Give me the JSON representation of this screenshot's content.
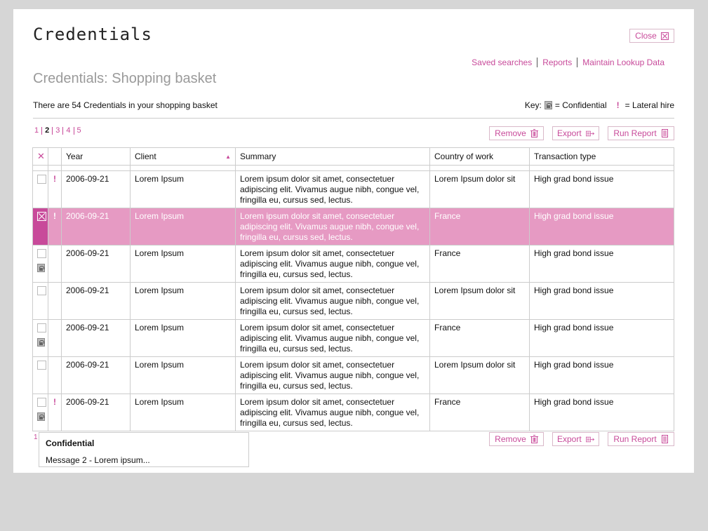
{
  "app": {
    "title": "Credentials",
    "close_label": "Close"
  },
  "nav": {
    "saved_searches": "Saved searches",
    "reports": "Reports",
    "maintain": "Maintain Lookup Data"
  },
  "page": {
    "title": "Credentials: Shopping basket",
    "count_text": "There are 54 Credentials in your shopping basket"
  },
  "key": {
    "label": "Key:",
    "confidential": "= Confidential",
    "lateral_symbol": "!",
    "lateral": "= Lateral hire"
  },
  "pager": {
    "pages": [
      "1",
      "2",
      "3",
      "4",
      "5"
    ],
    "current": "2"
  },
  "actions": {
    "remove": "Remove",
    "export": "Export",
    "run_report": "Run Report"
  },
  "table": {
    "header_check": "✕",
    "columns": [
      "Year",
      "Client",
      "Summary",
      "Country of work",
      "Transaction type"
    ],
    "rows": [
      {
        "checked": false,
        "lateral": true,
        "confidential": false,
        "year": "2006-09-21",
        "client": "Lorem Ipsum",
        "summary": "Lorem ipsum dolor sit amet, consectetuer adipiscing elit. Vivamus augue nibh, congue vel, fringilla eu, cursus sed, lectus.",
        "country": "Lorem Ipsum dolor sit",
        "transaction": "High grad bond issue"
      },
      {
        "checked": true,
        "lateral": true,
        "confidential": false,
        "year": "2006-09-21",
        "client": "Lorem Ipsum",
        "summary": "Lorem ipsum dolor sit amet, consectetuer adipiscing elit. Vivamus augue nibh, congue vel, fringilla eu, cursus sed, lectus.",
        "country": "France",
        "transaction": "High grad bond issue"
      },
      {
        "checked": false,
        "lateral": false,
        "confidential": true,
        "year": "2006-09-21",
        "client": "Lorem Ipsum",
        "summary": "Lorem ipsum dolor sit amet, consectetuer adipiscing elit. Vivamus augue nibh, congue vel, fringilla eu, cursus sed, lectus.",
        "country": "France",
        "transaction": "High grad bond issue"
      },
      {
        "checked": false,
        "lateral": false,
        "confidential": false,
        "year": "2006-09-21",
        "client": "Lorem Ipsum",
        "summary": "Lorem ipsum dolor sit amet, consectetuer adipiscing elit. Vivamus augue nibh, congue vel, fringilla eu, cursus sed, lectus.",
        "country": "Lorem Ipsum dolor sit",
        "transaction": "High grad bond issue"
      },
      {
        "checked": false,
        "lateral": false,
        "confidential": true,
        "year": "2006-09-21",
        "client": "Lorem Ipsum",
        "summary": "Lorem ipsum dolor sit amet, consectetuer adipiscing elit. Vivamus augue nibh, congue vel, fringilla eu, cursus sed, lectus.",
        "country": "France",
        "transaction": "High grad bond issue"
      },
      {
        "checked": false,
        "lateral": false,
        "confidential": false,
        "year": "2006-09-21",
        "client": "Lorem Ipsum",
        "summary": "Lorem ipsum dolor sit amet, consectetuer adipiscing elit. Vivamus augue nibh, congue vel, fringilla eu, cursus sed, lectus.",
        "country": "Lorem Ipsum dolor sit",
        "transaction": "High grad bond issue"
      },
      {
        "checked": false,
        "lateral": true,
        "confidential": true,
        "year": "2006-09-21",
        "client": "Lorem Ipsum",
        "summary": "Lorem ipsum dolor sit amet, consectetuer adipiscing elit. Vivamus augue nibh, congue vel, fringilla eu, cursus sed, lectus.",
        "country": "France",
        "transaction": "High grad bond issue"
      }
    ]
  },
  "footnote": {
    "number": "1",
    "title": "Confidential",
    "message": "Message 2 - Lorem ipsum..."
  },
  "colors": {
    "accent": "#c84a9a",
    "selected_row": "#e69ac3",
    "title_gray": "#9a9a9a",
    "background": "#d6d6d6"
  },
  "icons": {
    "close": "close-box-icon",
    "remove": "trash-icon",
    "export": "export-icon",
    "run_report": "report-icon",
    "confidential": "lock-icon",
    "sort": "sort-up-icon"
  }
}
